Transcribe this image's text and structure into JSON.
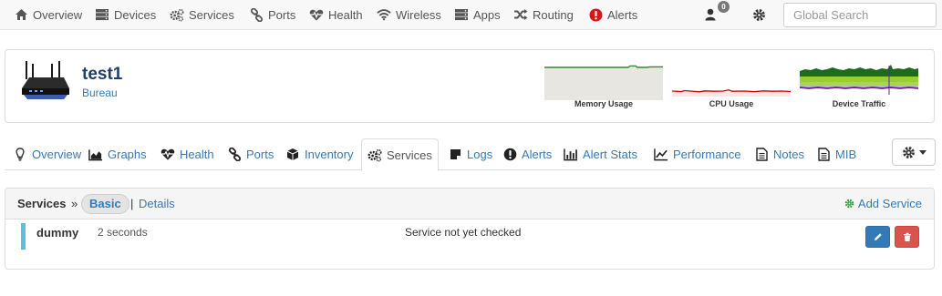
{
  "topnav": {
    "items": [
      {
        "label": "Overview",
        "icon": "home-icon"
      },
      {
        "label": "Devices",
        "icon": "server-icon"
      },
      {
        "label": "Services",
        "icon": "cogs-icon"
      },
      {
        "label": "Ports",
        "icon": "link-icon"
      },
      {
        "label": "Health",
        "icon": "heartbeat-icon"
      },
      {
        "label": "Wireless",
        "icon": "wifi-icon"
      },
      {
        "label": "Apps",
        "icon": "apps-icon"
      },
      {
        "label": "Routing",
        "icon": "random-icon"
      },
      {
        "label": "Alerts",
        "icon": "exclamation-circle-icon"
      }
    ],
    "user_badge": "0",
    "search_placeholder": "Global Search"
  },
  "device": {
    "name": "test1",
    "location": "Bureau",
    "graphs": [
      {
        "label": "Memory Usage",
        "color": "#2e8b2e"
      },
      {
        "label": "CPU Usage",
        "color": "#cc0000"
      },
      {
        "label": "Device Traffic",
        "color": "#9acd32"
      }
    ]
  },
  "tabs": {
    "items": [
      {
        "label": "Overview",
        "icon": "lightbulb-icon"
      },
      {
        "label": "Graphs",
        "icon": "area-chart-icon"
      },
      {
        "label": "Health",
        "icon": "heartbeat-icon"
      },
      {
        "label": "Ports",
        "icon": "link-icon"
      },
      {
        "label": "Inventory",
        "icon": "cube-icon"
      },
      {
        "label": "Services",
        "icon": "cogs-icon",
        "active": true
      },
      {
        "label": "Logs",
        "icon": "sticky-note-icon"
      },
      {
        "label": "Alerts",
        "icon": "exclamation-circle-icon"
      },
      {
        "label": "Alert Stats",
        "icon": "bar-chart-icon"
      },
      {
        "label": "Performance",
        "icon": "line-chart-icon"
      },
      {
        "label": "Notes",
        "icon": "file-text-icon"
      },
      {
        "label": "MIB",
        "icon": "file-text-icon"
      }
    ]
  },
  "services": {
    "title": "Services",
    "separator": "»",
    "basic_label": "Basic",
    "pipe": "|",
    "details_label": "Details",
    "add_label": "Add Service",
    "rows": [
      {
        "name": "dummy",
        "time": "2 seconds",
        "message": "Service not yet checked"
      }
    ]
  },
  "colors": {
    "link": "#337ab7",
    "status_bar": "#5bc0de",
    "edit_button": "#337ab7",
    "delete_button": "#d9534f",
    "add_icon": "#3c9c3c"
  }
}
